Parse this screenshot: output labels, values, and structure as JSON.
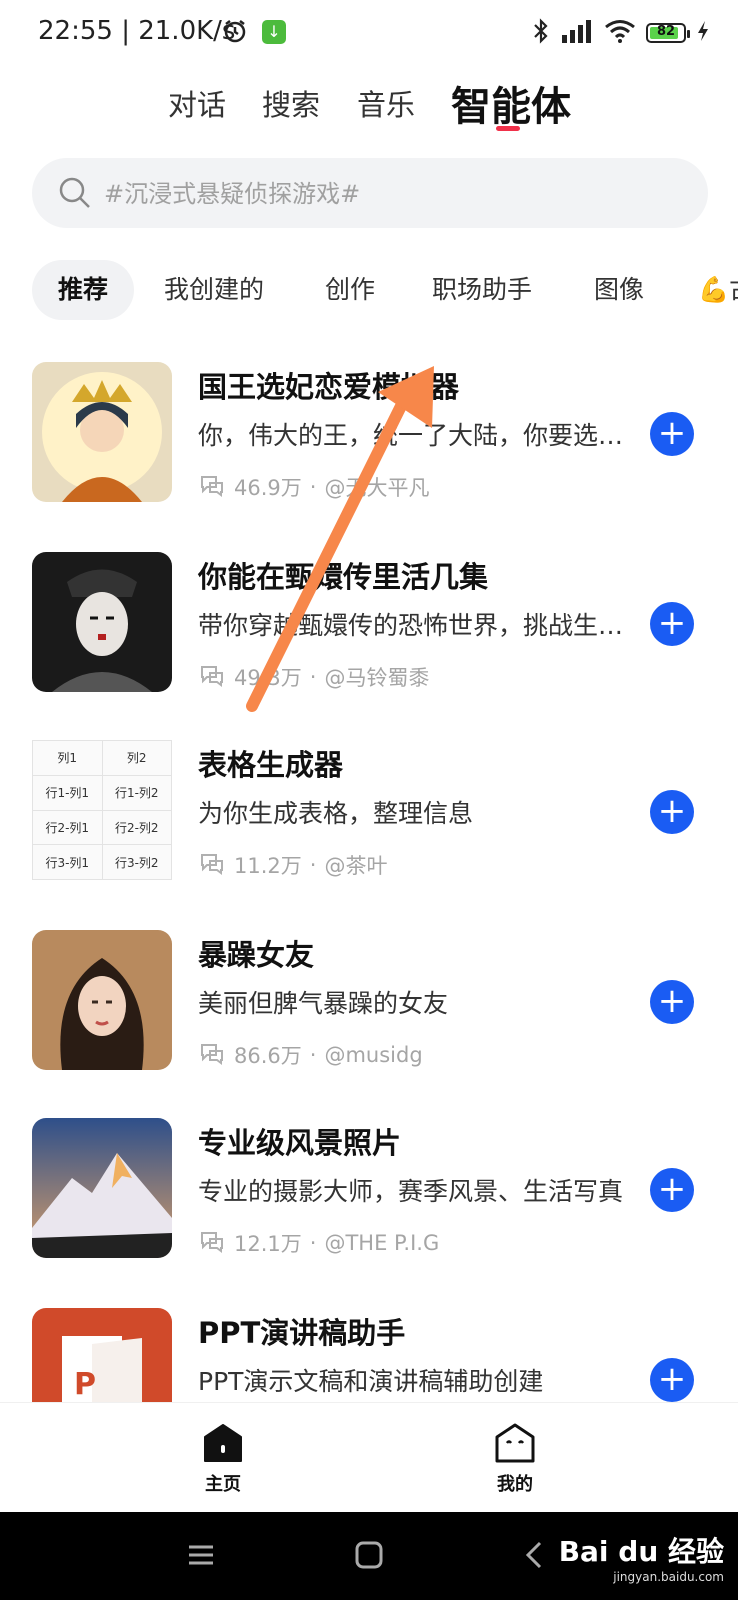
{
  "status": {
    "time": "22:55 | 21.0K/s",
    "battery": "82"
  },
  "tabs": [
    {
      "label": "对话"
    },
    {
      "label": "搜索"
    },
    {
      "label": "音乐"
    },
    {
      "label": "智能体"
    }
  ],
  "search": {
    "placeholder": "#沉浸式悬疑侦探游戏#"
  },
  "categories": [
    {
      "label": "推荐"
    },
    {
      "label": "我创建的"
    },
    {
      "label": "创作"
    },
    {
      "label": "职场助手"
    },
    {
      "label": "图像"
    },
    {
      "label": "💪古"
    }
  ],
  "items": [
    {
      "title": "国王选妃恋爱模拟器",
      "desc": "你，伟大的王，统一了大陆，你要选妃了",
      "count": "46.9万",
      "author": "@无大平凡"
    },
    {
      "title": "你能在甄嬛传里活几集",
      "desc": "带你穿越甄嬛传的恐怖世界，挑战生存极限",
      "count": "49.3万",
      "author": "@马铃蜀黍"
    },
    {
      "title": "表格生成器",
      "desc": "为你生成表格，整理信息",
      "count": "11.2万",
      "author": "@茶叶"
    },
    {
      "title": "暴躁女友",
      "desc": "美丽但脾气暴躁的女友",
      "count": "86.6万",
      "author": "@musidg"
    },
    {
      "title": "专业级风景照片",
      "desc": "专业的摄影大师，赛季风景、生活写真",
      "count": "12.1万",
      "author": "@THE P.I.G"
    },
    {
      "title": "PPT演讲稿助手",
      "desc": "PPT演示文稿和演讲稿辅助创建",
      "count": "",
      "author": ""
    }
  ],
  "table_thumb": {
    "header": [
      "列1",
      "列2"
    ],
    "rows": [
      [
        "行1-列1",
        "行1-列2"
      ],
      [
        "行2-列1",
        "行2-列2"
      ],
      [
        "行3-列1",
        "行3-列2"
      ]
    ]
  },
  "bottom_nav": [
    {
      "label": "主页"
    },
    {
      "label": "我的"
    }
  ],
  "watermark": {
    "brand": "Bai du 经验",
    "url": "jingyan.baidu.com"
  },
  "colors": {
    "accent_blue": "#1a5cf3",
    "tab_underline": "#f0314a",
    "annotation_arrow": "#f7874a"
  }
}
